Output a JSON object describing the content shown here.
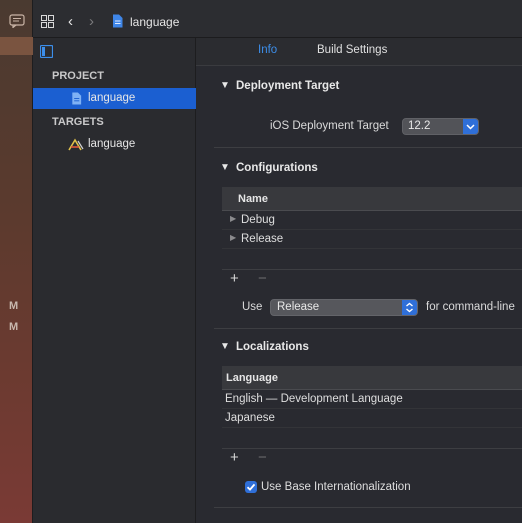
{
  "left_strip": {
    "markers": [
      "M",
      "M"
    ]
  },
  "topbar": {
    "file_title": "language"
  },
  "sidebar": {
    "project_header": "PROJECT",
    "project_item": "language",
    "targets_header": "TARGETS",
    "target_item": "language"
  },
  "tabs": {
    "info": "Info",
    "build_settings": "Build Settings"
  },
  "deployment": {
    "title": "Deployment Target",
    "ios_label": "iOS Deployment Target",
    "ios_value": "12.2"
  },
  "configurations": {
    "title": "Configurations",
    "header": "Name",
    "rows": [
      "Debug",
      "Release"
    ],
    "use_label": "Use",
    "use_value": "Release",
    "use_suffix": "for command-line"
  },
  "localizations": {
    "title": "Localizations",
    "header": "Language",
    "rows": [
      "English — Development Language",
      "Japanese"
    ],
    "base_i18n_label": "Use Base Internationalization",
    "base_i18n_checked": true
  },
  "colors": {
    "accent": "#1b5fd1",
    "tab_active": "#3c8eea"
  },
  "controls": {
    "add": "+",
    "remove": "−"
  }
}
